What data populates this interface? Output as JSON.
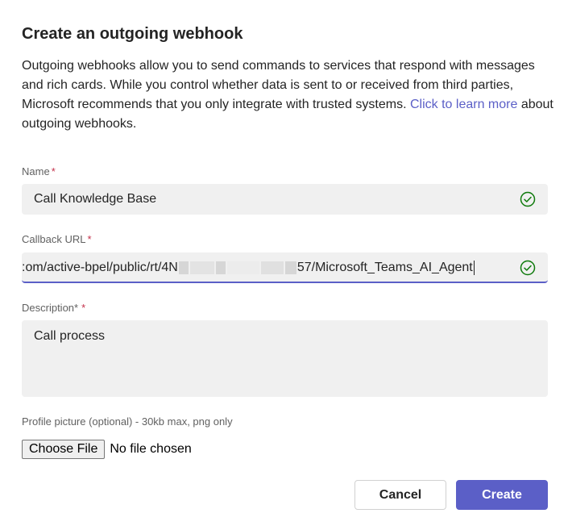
{
  "dialog": {
    "title": "Create an outgoing webhook",
    "intro_text": "Outgoing webhooks allow you to send commands to services that respond with messages and rich cards. While you control whether data is sent to or received from third parties, Microsoft recommends that you only integrate with trusted systems.",
    "learn_more_link": "Click to learn more",
    "intro_suffix": "about outgoing webhooks."
  },
  "form": {
    "name": {
      "label": "Name",
      "required_mark": "*",
      "value": "Call Knowledge Base"
    },
    "callback_url": {
      "label": "Callback URL",
      "required_mark": "*",
      "value_start": ":om/active-bpel/public/rt/4N",
      "value_end": "57/Microsoft_Teams_AI_Agent"
    },
    "description": {
      "label": "Description*",
      "required_mark": "*",
      "value": "Call process"
    },
    "profile_picture": {
      "label": "Profile picture (optional) - 30kb max, png only",
      "button_label": "Choose File",
      "status": "No file chosen"
    }
  },
  "actions": {
    "cancel_label": "Cancel",
    "create_label": "Create"
  },
  "colors": {
    "accent": "#5b5fc7",
    "valid_check": "#0e7a0b",
    "required": "#c4314b",
    "field_bg": "#f0f0f0"
  },
  "icons": {
    "valid": "check-circle-icon"
  }
}
